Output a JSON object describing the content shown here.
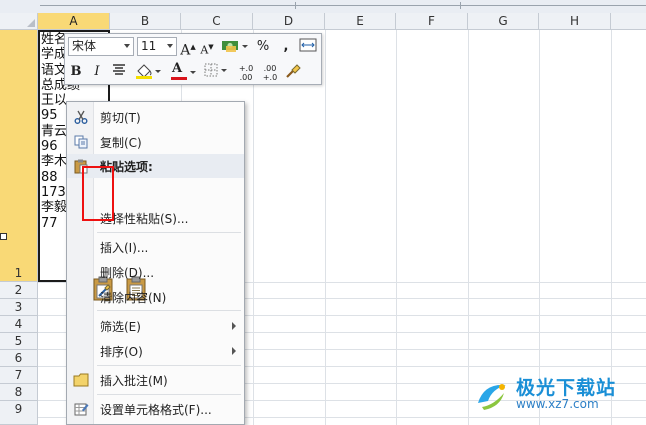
{
  "columns": [
    "A",
    "B",
    "C",
    "D",
    "E",
    "F",
    "G",
    "H"
  ],
  "rows": [
    "1",
    "2",
    "3",
    "4",
    "5",
    "6",
    "7",
    "8",
    "9"
  ],
  "cell_a1_lines": [
    "姓名",
    "学成",
    "语文",
    "总成绩",
    "王以",
    "95",
    "青云",
    "96",
    "李木",
    "88",
    "173",
    "李毅",
    "77"
  ],
  "mini_toolbar": {
    "font_name": "宋体",
    "font_size": "11",
    "grow_font": "A",
    "shrink_font": "A",
    "percent": "%",
    "comma": ",",
    "bold": "B",
    "italic": "I",
    "font_color": "A",
    "increase_decimal": "+.0 .00",
    "decrease_decimal": ".00 +.0"
  },
  "context_menu": {
    "cut": "剪切(T)",
    "copy": "复制(C)",
    "paste_options": "粘贴选项:",
    "paste_special": "选择性粘贴(S)...",
    "insert": "插入(I)...",
    "delete": "删除(D)...",
    "clear_contents": "清除内容(N)",
    "filter": "筛选(E)",
    "sort": "排序(O)",
    "insert_comment": "插入批注(M)",
    "format_cells": "设置单元格格式(F)..."
  },
  "watermark": {
    "name": "极光下载站",
    "url": "www.xz7.com"
  },
  "colors": {
    "selected_header": "#f9d976",
    "highlight_box": "#ee1111",
    "font_color_bar": "#d9141c",
    "fill_color_bar": "#f5e000"
  }
}
